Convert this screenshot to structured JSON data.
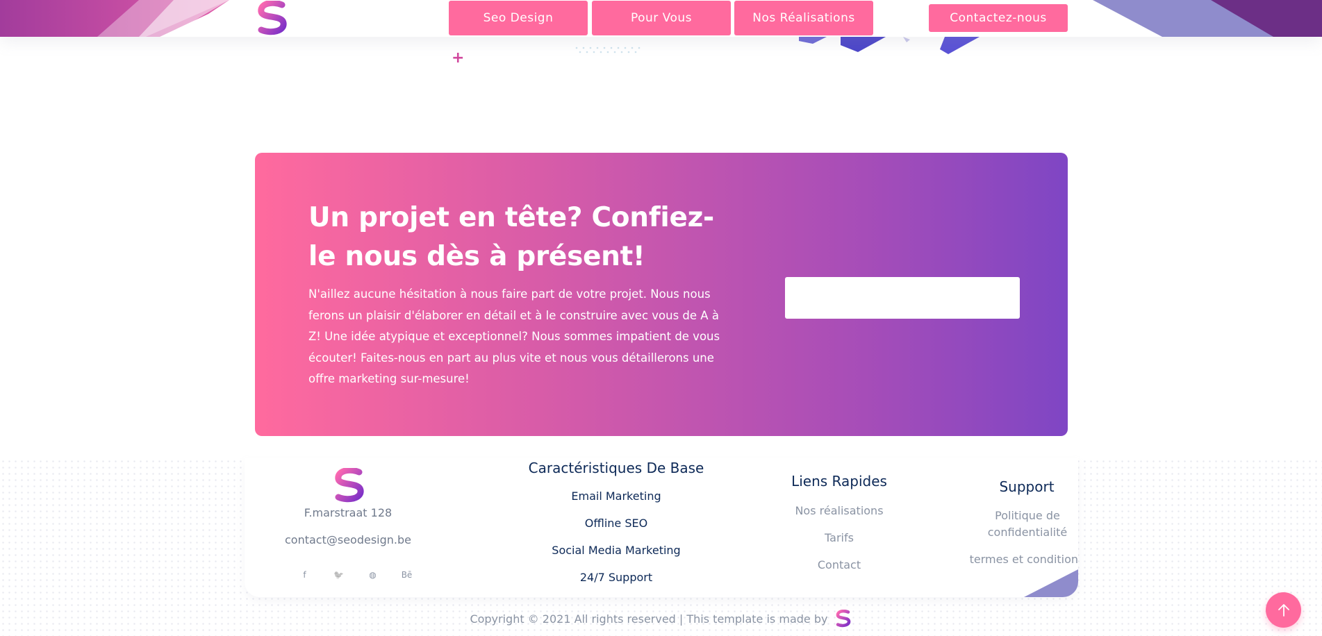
{
  "header": {
    "logo_icon": "seodesign-s-logo",
    "nav": [
      {
        "label": "Seo Design"
      },
      {
        "label": "Pour Vous"
      },
      {
        "label": "Nos Réalisations"
      }
    ],
    "contact_label": "Contactez-nous"
  },
  "cta": {
    "title": "Un projet en tête? Confiez-le nous dès à présent!",
    "text": "N'aillez aucune hésitation à nous faire part de votre projet. Nous nous ferons un plaisir d'élaborer en détail et à le construire avec vous de A à Z! Une idée atypique et exceptionnel? Nous sommes impatient de vous écouter! Faites-nous en part au plus vite et nous vous détaillerons une offre marketing sur-mesure!",
    "input_value": ""
  },
  "footer": {
    "address": "F.marstraat 128",
    "email": "contact@seodesign.be",
    "socials": [
      {
        "icon": "facebook-icon",
        "glyph": "f"
      },
      {
        "icon": "twitter-icon",
        "glyph": "🐦"
      },
      {
        "icon": "globe-icon",
        "glyph": "◍"
      },
      {
        "icon": "behance-icon",
        "glyph": "Bē"
      }
    ],
    "features": {
      "title": "Caractéristiques De Base",
      "links": [
        "Email Marketing",
        "Offline SEO",
        "Social Media Marketing",
        "24/7 Support"
      ]
    },
    "quick_links": {
      "title": "Liens Rapides",
      "links": [
        "Nos réalisations",
        "Tarifs",
        "Contact"
      ]
    },
    "support": {
      "title": "Support",
      "links": [
        "Politique de confidentialité",
        "termes et conditions"
      ]
    },
    "copyright": "Copyright © 2021 All rights reserved | This template is made by"
  },
  "colors": {
    "accent_pink": "#ff6a9e",
    "accent_purple": "#7f46c4",
    "navy": "#0d2957"
  },
  "back_to_top_icon": "arrow-up-icon"
}
